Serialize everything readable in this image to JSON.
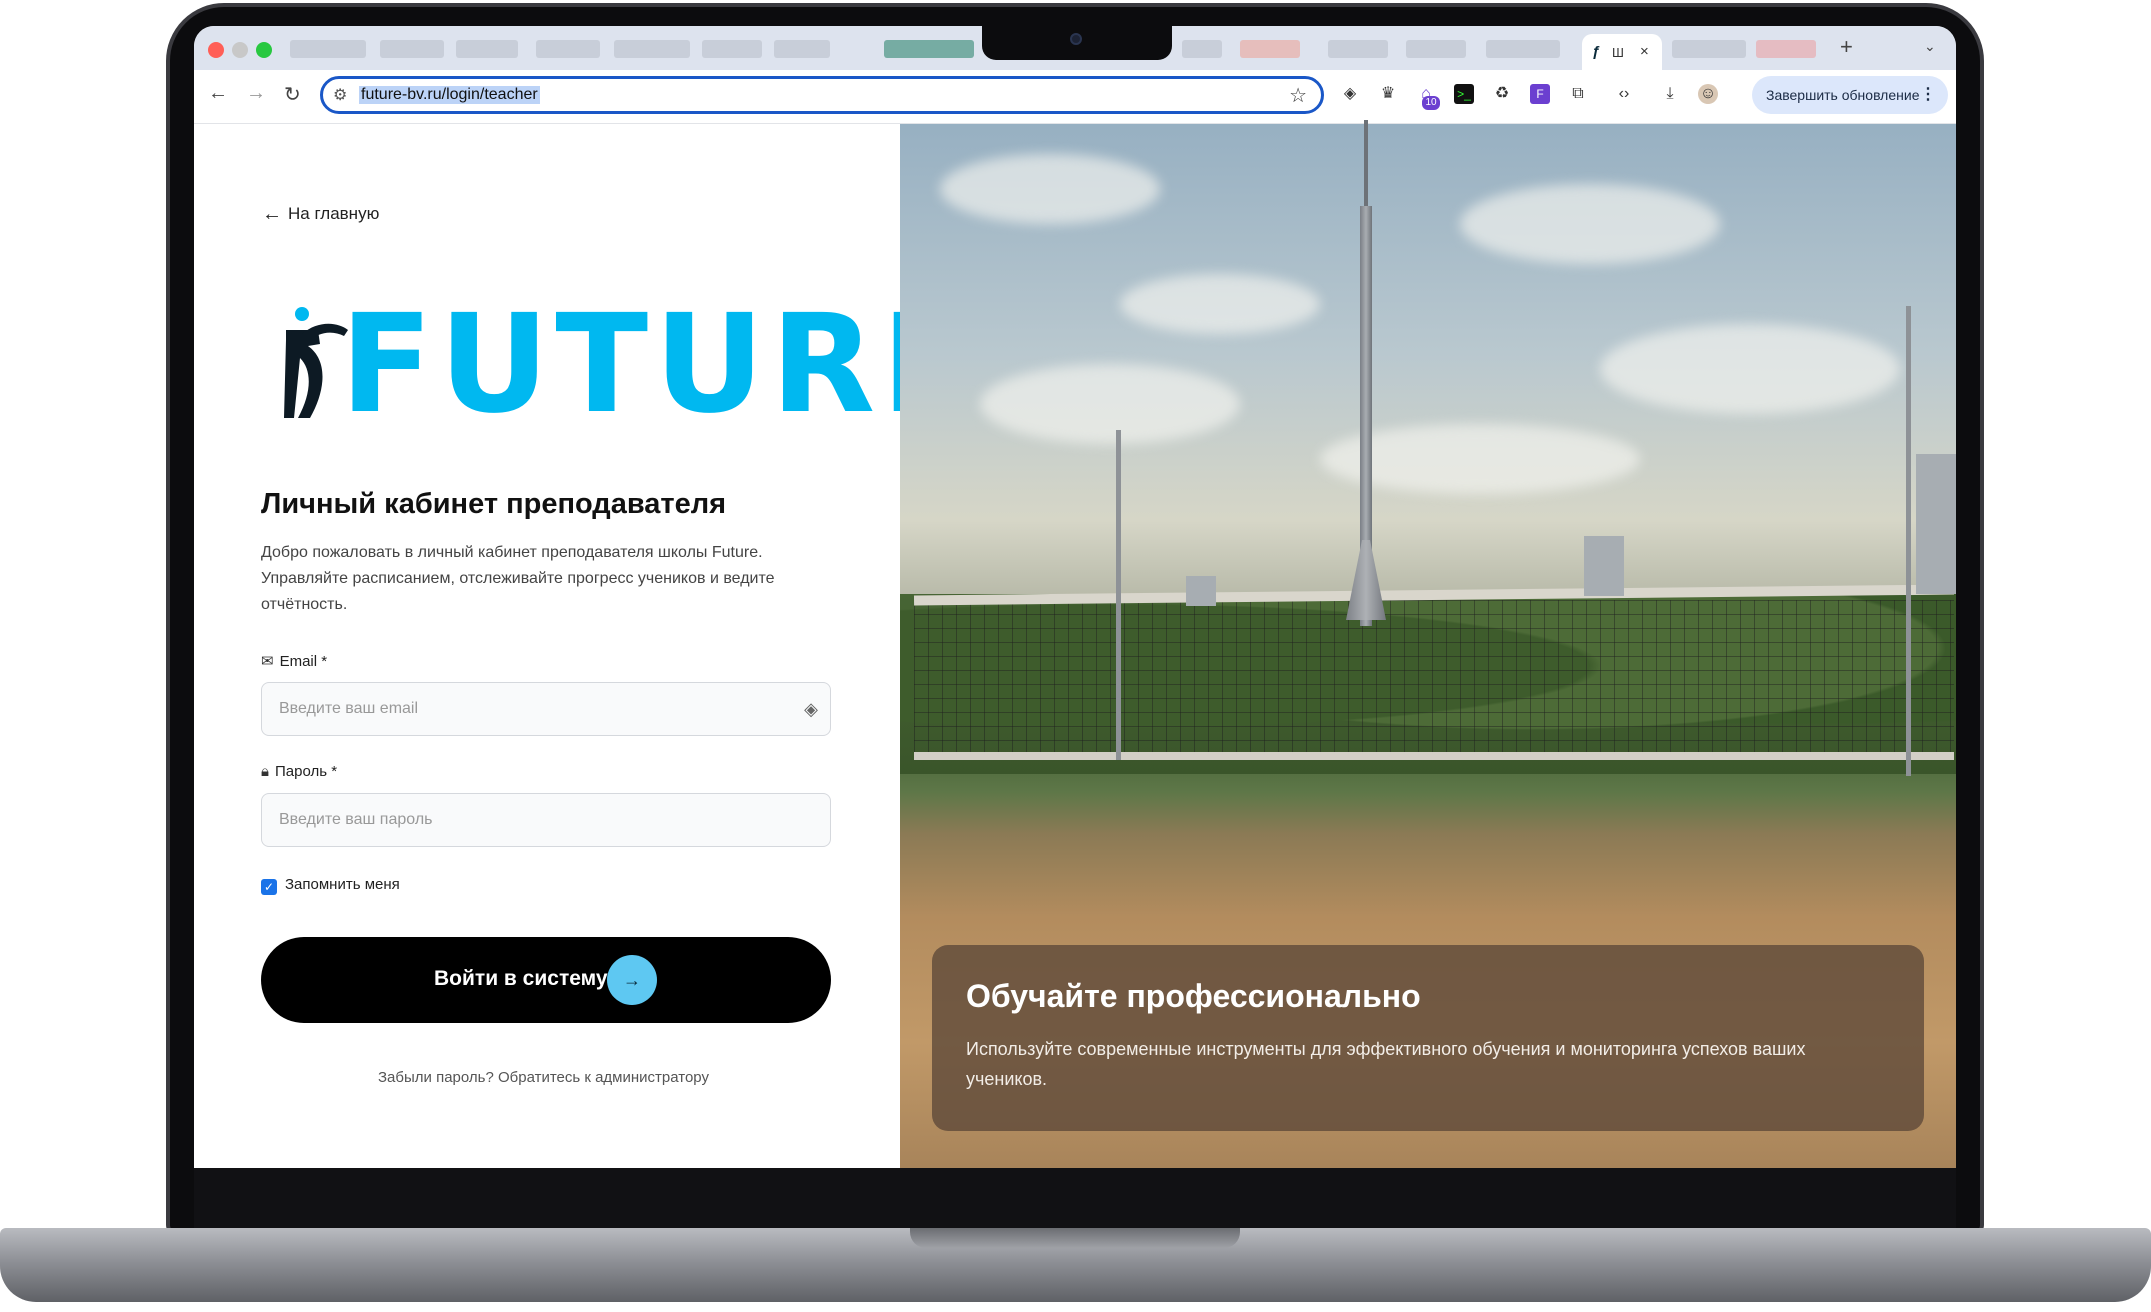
{
  "browser": {
    "active_tab_title": "Ш",
    "url": "future-bv.ru/login/teacher",
    "update_button": "Завершить обновление",
    "extension_badge": "10"
  },
  "page": {
    "back_link": "На главную",
    "logo_text": "FUTURE",
    "title": "Личный кабинет преподавателя",
    "description": "Добро пожаловать в личный кабинет преподавателя школы Future. Управляйте расписанием, отслеживайте прогресс учеников и ведите отчётность.",
    "email_label": "Email *",
    "email_placeholder": "Введите ваш email",
    "password_label": "Пароль *",
    "password_placeholder": "Введите ваш пароль",
    "remember_label": "Запомнить меня",
    "remember_checked": true,
    "login_button": "Войти в систему",
    "forgot_text": "Забыли пароль? Обратитесь к администратору"
  },
  "hero": {
    "title": "Обучайте профессионально",
    "text": "Используйте современные инструменты для эффективного обучения и мониторинга успехов ваших учеников."
  },
  "colors": {
    "brand": "#00b8f0",
    "button": "#000000",
    "button_accent": "#5ec8f2",
    "focus": "#1a57c7"
  }
}
